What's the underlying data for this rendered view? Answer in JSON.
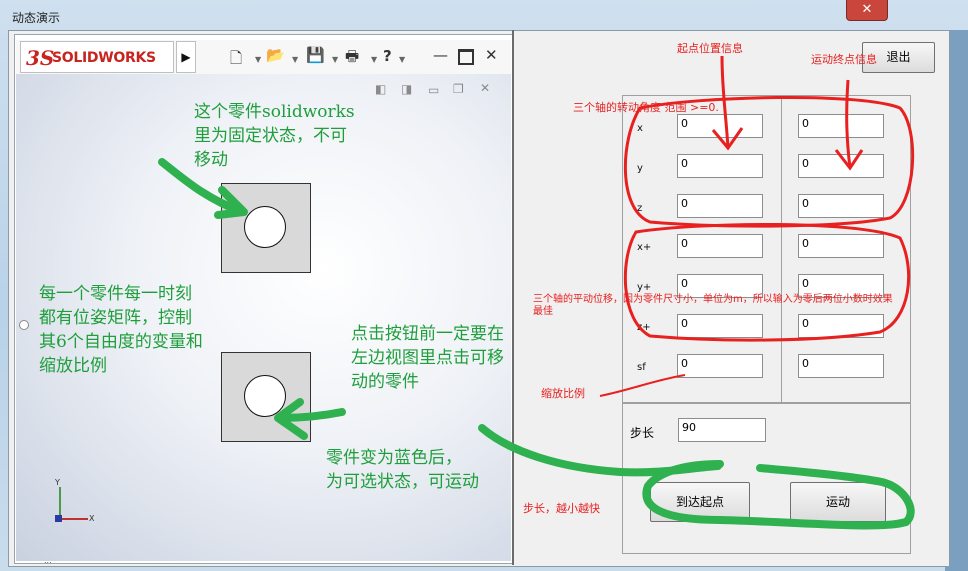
{
  "window": {
    "title": "动态演示",
    "close_glyph": "✕"
  },
  "solidworks": {
    "logo_mark": "3S",
    "logo_text": "SOLIDWORKS",
    "axis_x": "X",
    "axis_y": "Y",
    "footer_text": "..."
  },
  "annotations_green": {
    "fixed_part": [
      "这个零件solidworks",
      "里为固定状态，不可",
      "移动"
    ],
    "pose_matrix": [
      "每一个零件每一时刻",
      "都有位姿矩阵，控制",
      "其6个自由度的变量和",
      "缩放比例"
    ],
    "click_first": [
      "点击按钮前一定要在",
      "左边视图里点击可移",
      "动的零件"
    ],
    "blue_selected": [
      "零件变为蓝色后，",
      "为可选状态，可运动"
    ]
  },
  "annotations_red": {
    "start_info": "起点位置信息",
    "end_info": "运动终点信息",
    "rotation_range": "三个轴的转动角度  范围 >=0.",
    "translation_note": "三个轴的平动位移，因为零件尺寸小，单位为m，所以输入为零后两位小数时效果",
    "translation_note2": "最佳",
    "scale": "缩放比例",
    "step_note": "步长，越小越快"
  },
  "controls": {
    "exit_label": "退出",
    "rows": [
      {
        "label": "x",
        "start": "0",
        "end": "0"
      },
      {
        "label": "y",
        "start": "0",
        "end": "0"
      },
      {
        "label": "z",
        "start": "0",
        "end": "0"
      },
      {
        "label": "x+",
        "start": "0",
        "end": "0"
      },
      {
        "label": "y+",
        "start": "0",
        "end": "0"
      },
      {
        "label": "z+",
        "start": "0",
        "end": "0"
      },
      {
        "label": "sf",
        "start": "0",
        "end": "0"
      }
    ],
    "step_label": "步长",
    "step_value": "90",
    "goto_start_label": "到达起点",
    "move_label": "运动"
  },
  "colors": {
    "annotation_green": "#1f9e3c",
    "annotation_red": "#e82020",
    "sw_red": "#c8241f"
  }
}
